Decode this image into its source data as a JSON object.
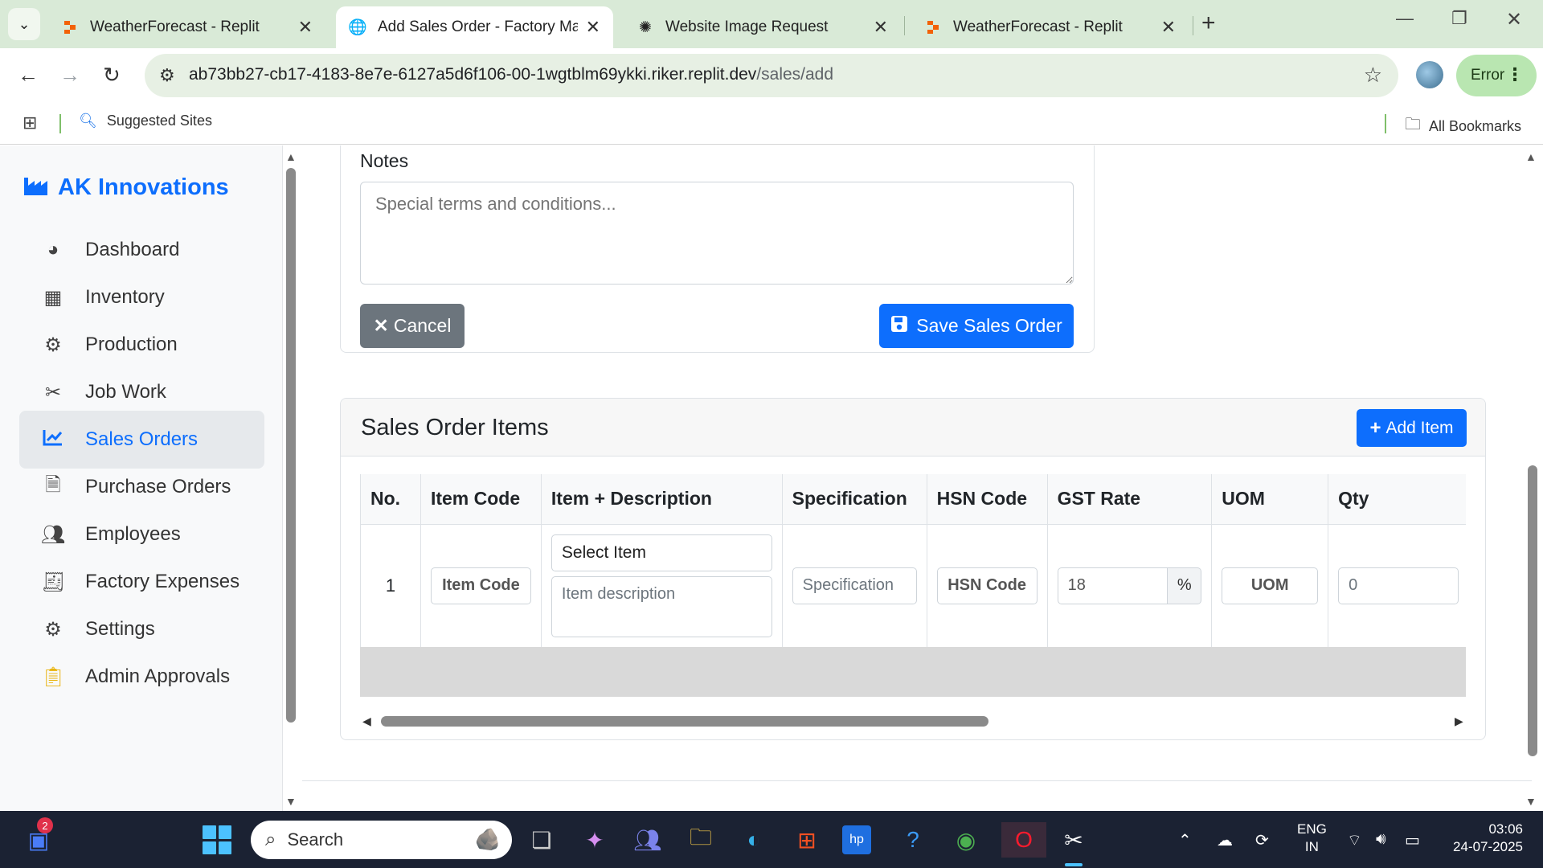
{
  "browser": {
    "tabs": [
      {
        "title": "WeatherForecast - Replit",
        "icon": "replit-icon"
      },
      {
        "title": "Add Sales Order - Factory Management",
        "icon": "globe-icon",
        "active": true
      },
      {
        "title": "Website Image Request",
        "icon": "openai-icon"
      },
      {
        "title": "WeatherForecast - Replit",
        "icon": "replit-icon"
      }
    ],
    "url_host": "ab73bb27-cb17-4183-8e7e-6127a5d6f106-00-1wgtblm69ykki.riker.replit.dev",
    "url_path": "/sales/add",
    "status_pill": "Error",
    "bookmarks": {
      "suggested": "Suggested Sites",
      "all": "All Bookmarks"
    }
  },
  "sidebar": {
    "brand": "AK Innovations",
    "items": [
      {
        "label": "Dashboard",
        "icon": "gauge-icon"
      },
      {
        "label": "Inventory",
        "icon": "boxes-icon"
      },
      {
        "label": "Production",
        "icon": "cogs-icon"
      },
      {
        "label": "Job Work",
        "icon": "tools-icon"
      },
      {
        "label": "Sales Orders",
        "icon": "chart-line-icon",
        "active": true
      },
      {
        "label": "Purchase Orders",
        "icon": "invoice-icon"
      },
      {
        "label": "Employees",
        "icon": "users-icon"
      },
      {
        "label": "Factory Expenses",
        "icon": "receipt-icon"
      },
      {
        "label": "Settings",
        "icon": "gear-icon"
      },
      {
        "label": "Admin Approvals",
        "icon": "clipboard-check-icon"
      }
    ]
  },
  "form": {
    "notes_label": "Notes",
    "notes_placeholder": "Special terms and conditions...",
    "cancel_label": "Cancel",
    "save_label": "Save Sales Order"
  },
  "items_card": {
    "title": "Sales Order Items",
    "add_label": "Add Item",
    "columns": [
      "No.",
      "Item Code",
      "Item + Description",
      "Specification",
      "HSN Code",
      "GST Rate",
      "UOM",
      "Qty"
    ],
    "row": {
      "no": "1",
      "item_code_placeholder": "Item Code",
      "select_item": "Select Item",
      "description_placeholder": "Item description",
      "specification_placeholder": "Specification",
      "hsn_placeholder": "HSN Code",
      "gst_value": "18",
      "gst_unit": "%",
      "uom_placeholder": "UOM",
      "qty_placeholder": "0"
    }
  },
  "taskbar": {
    "search_placeholder": "Search",
    "notification_count": "2",
    "lang": "ENG",
    "region": "IN",
    "time": "03:06",
    "date": "24-07-2025"
  },
  "colors": {
    "primary": "#0d6efd",
    "secondary": "#6c757d",
    "tab_bar": "#d9ead7"
  }
}
